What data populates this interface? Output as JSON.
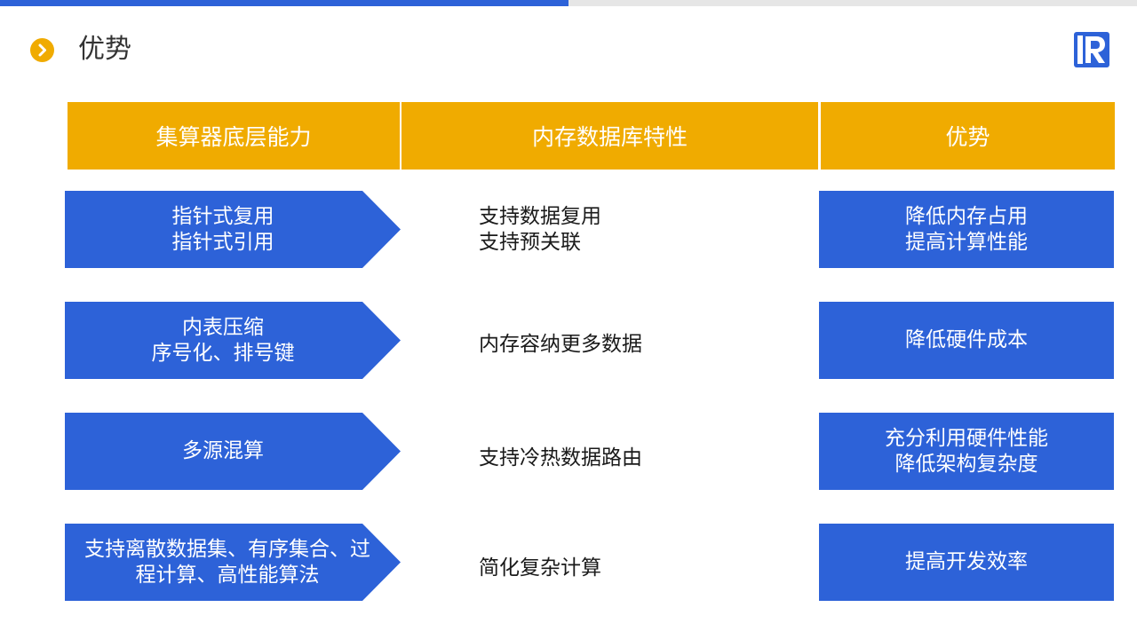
{
  "page": {
    "title": "优势"
  },
  "colors": {
    "accent_blue": "#2d62d8",
    "accent_orange": "#f0ab00",
    "bar_gray": "#e6e6e6"
  },
  "icons": {
    "title_bullet": "chevron-right-circle-icon",
    "logo": "r-logo-icon"
  },
  "table": {
    "headers": [
      "集算器底层能力",
      "内存数据库特性",
      "优势"
    ],
    "rows": [
      {
        "capability": [
          "指针式复用",
          "指针式引用"
        ],
        "feature": [
          "支持数据复用",
          "支持预关联"
        ],
        "advantage": [
          "降低内存占用",
          "提高计算性能"
        ]
      },
      {
        "capability": [
          "内表压缩",
          "序号化、排号键"
        ],
        "feature": [
          "内存容纳更多数据"
        ],
        "advantage": [
          "降低硬件成本"
        ]
      },
      {
        "capability": [
          "多源混算"
        ],
        "feature": [
          "支持冷热数据路由"
        ],
        "advantage": [
          "充分利用硬件性能",
          "降低架构复杂度"
        ]
      },
      {
        "capability": [
          "支持离散数据集、有序集合、过",
          "程计算、高性能算法"
        ],
        "feature": [
          "简化复杂计算"
        ],
        "advantage": [
          "提高开发效率"
        ]
      }
    ]
  }
}
